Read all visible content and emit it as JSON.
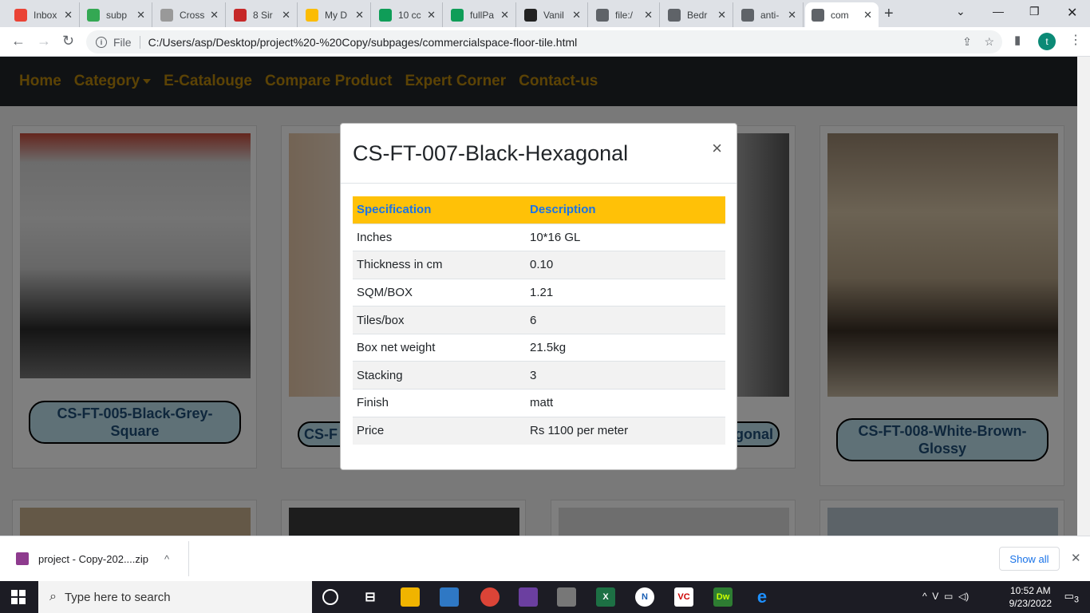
{
  "browser": {
    "tabs": [
      {
        "title": "Inbox",
        "icon": "gmail-icon",
        "color": "#ea4335"
      },
      {
        "title": "subp",
        "icon": "drive-icon",
        "color": "#34a853"
      },
      {
        "title": "Cross",
        "icon": "css-icon",
        "color": "#999999"
      },
      {
        "title": "8 Sir",
        "icon": "w-icon",
        "color": "#c62828"
      },
      {
        "title": "My D",
        "icon": "drive-icon",
        "color": "#fbbc04"
      },
      {
        "title": "10 cc",
        "icon": "doc-icon",
        "color": "#0f9d58"
      },
      {
        "title": "fullPa",
        "icon": "doc-icon",
        "color": "#0f9d58"
      },
      {
        "title": "Vanil",
        "icon": "codepen-icon",
        "color": "#222222"
      },
      {
        "title": "file:/",
        "icon": "globe-icon",
        "color": "#5f6368"
      },
      {
        "title": "Bedr",
        "icon": "globe-icon",
        "color": "#5f6368"
      },
      {
        "title": "anti-",
        "icon": "globe-icon",
        "color": "#5f6368"
      },
      {
        "title": "com",
        "icon": "globe-icon",
        "color": "#5f6368",
        "active": true
      }
    ],
    "scheme": "File",
    "url": "C:/Users/asp/Desktop/project%20-%20Copy/subpages/commercialspace-floor-tile.html",
    "profile_initial": "t"
  },
  "site_nav": {
    "items": [
      "Home",
      "Category",
      "E-Catalouge",
      "Compare Product",
      "Expert Corner",
      "Contact-us"
    ]
  },
  "cards": [
    {
      "caption": "CS-FT-005-Black-Grey-Square"
    },
    {
      "caption": "CS-F"
    },
    {
      "caption": "gonal"
    },
    {
      "caption": "CS-FT-008-White-Brown-Glossy"
    }
  ],
  "modal": {
    "title": "CS-FT-007-Black-Hexagonal",
    "close": "×",
    "headers": [
      "Specification",
      "Description"
    ],
    "rows": [
      [
        "Inches",
        "10*16 GL"
      ],
      [
        "Thickness in cm",
        "0.10"
      ],
      [
        "SQM/BOX",
        "1.21"
      ],
      [
        "Tiles/box",
        "6"
      ],
      [
        "Box net weight",
        "21.5kg"
      ],
      [
        "Stacking",
        "3"
      ],
      [
        "Finish",
        "matt"
      ],
      [
        "Price",
        "Rs 1100 per meter"
      ]
    ]
  },
  "download": {
    "filename": "project - Copy-202....zip",
    "show_all": "Show all"
  },
  "taskbar": {
    "search_placeholder": "Type here to search",
    "time": "10:52 AM",
    "date": "9/23/2022",
    "notifications": "3"
  }
}
